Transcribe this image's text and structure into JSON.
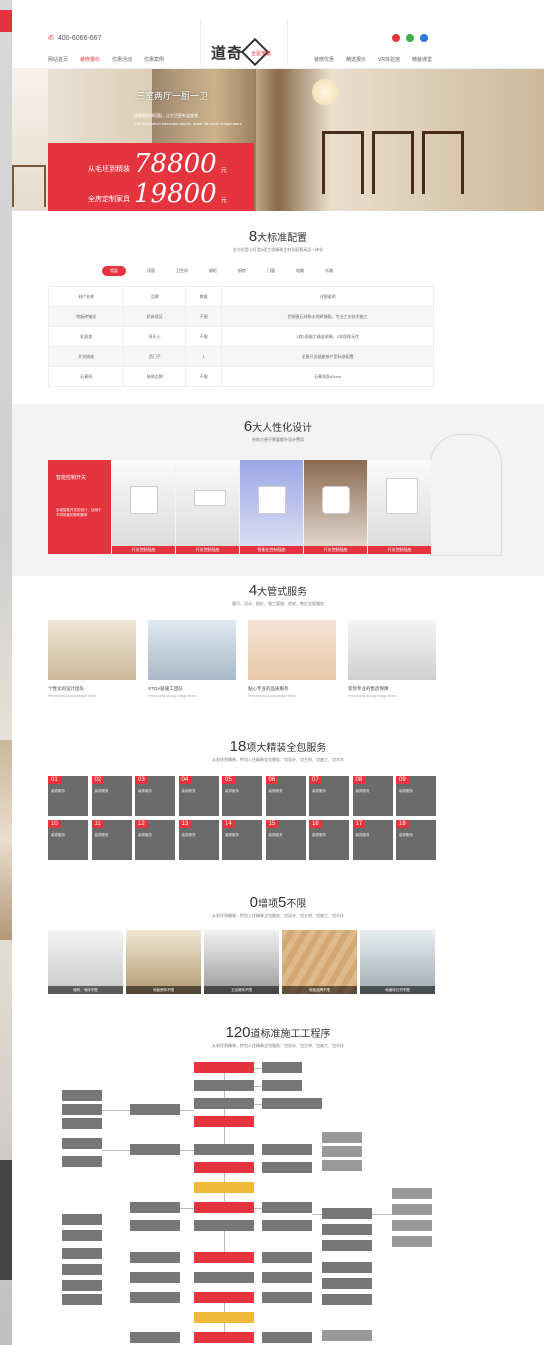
{
  "header": {
    "phone": "400-6066-667",
    "nav_left": [
      "网站首页",
      "装修报价",
      "优惠活动",
      "优惠案例"
    ],
    "nav_right": [
      "装修优惠",
      "精选报价",
      "VR体验馆",
      "精装课堂"
    ],
    "logo_text": "道奇",
    "logo_sub": "全屋家装",
    "social_colors": [
      "#e5343d",
      "#3aae49",
      "#2b7bd6"
    ]
  },
  "hero": {
    "tagline": "三室两厅一厨一卫",
    "desc1": "经典黑色调搭配，让生活更有温度感",
    "desc2": "The decoration becomes simple, make life more temperature",
    "row1_label": "从毛坯到精装",
    "row1_price": "78800",
    "row2_label": "全房定制家具",
    "row2_price": "19800",
    "unit": "元"
  },
  "standard": {
    "num": "8",
    "title": "大标准配置",
    "subtitle": "全方位是心打造8项工程精装主材及配套高品一体化",
    "tabs": [
      "墙面",
      "顶面",
      "卫生间",
      "橱柜",
      "厨房",
      "门窗",
      "电路",
      "水路"
    ],
    "active_tab": 0,
    "table_rows": [
      [
        "材产名称",
        "品牌",
        "数量",
        "详细说明"
      ],
      [
        "地板砖铺设",
        "机床保证",
        "不限",
        "铝钢直石材胶水地砖铺贴，专业工艺技术施工"
      ],
      [
        "乳胶漆",
        "多乐士",
        "不限",
        "1底2面施工精益求精，2年保修无忧"
      ],
      [
        "开关插座",
        "西门子",
        "1",
        "全屋开关插座按户型标准配置"
      ],
      [
        "石膏线",
        "装修品牌",
        "不限",
        "石膏线条80mm"
      ]
    ]
  },
  "humanized": {
    "num": "6",
    "title": "大人性化设计",
    "subtitle": "给你方便不需要额外设计费用",
    "first_card_title": "智能控制开关",
    "first_card_desc": "多组智能开关的设计，适用于不同场景的照明需求",
    "cards": [
      "开关控制插座",
      "开关控制插座",
      "智能化控制插座",
      "开关控制插座",
      "开关控制插座"
    ]
  },
  "service": {
    "num": "4",
    "title": "大管式服务",
    "subtitle": "量尺、设计、报价、施工管理、验收、售后全程服务",
    "items": [
      {
        "name": "个性化的设计团队",
        "en": "Personality young design team"
      },
      {
        "name": "STGA级施工团队",
        "en": "Personality young design team"
      },
      {
        "name": "贴心专业的品质服务",
        "en": "Personality young design team"
      },
      {
        "name": "装饰专业的售后保障",
        "en": "Personality young design team"
      }
    ]
  },
  "package": {
    "num": "18",
    "title": "项大精装全包服务",
    "subtitle": "从毛坯到精装，拎包入住精装全包服务：包设计、包主材、包施工、包木作",
    "cells": [
      "01",
      "02",
      "03",
      "04",
      "05",
      "06",
      "07",
      "08",
      "09",
      "10",
      "11",
      "12",
      "13",
      "14",
      "15",
      "16",
      "17",
      "18"
    ],
    "cell_text": "装修服务"
  },
  "zero": {
    "num": "0",
    "title": "增项",
    "num2": "5",
    "title2": "不限",
    "subtitle": "从毛坯到精装，拎包入住精装全包服务：包设计、包主材、包施工、包木作",
    "pics": [
      "墙砖、地砖不限",
      "地板瓷砖不限",
      "卫浴瓷砖不限",
      "地板品牌不限",
      "地面砖石材不限"
    ]
  },
  "process": {
    "num": "120",
    "title": "道标准施工工程序",
    "subtitle": "从毛坯到精装，拎包入住精装全包服务：包设计、包主材、包施工、包木作"
  }
}
